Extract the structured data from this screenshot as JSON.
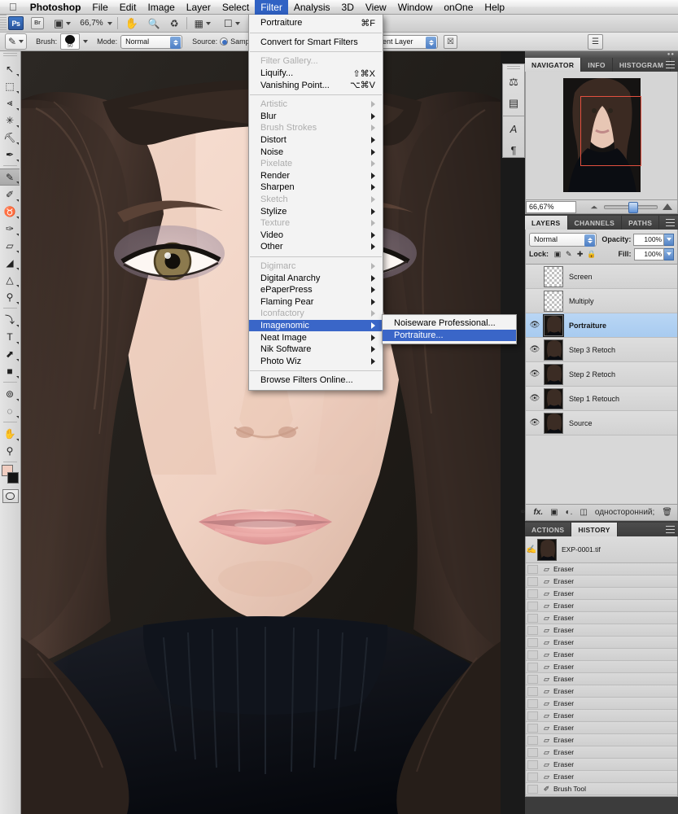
{
  "menubar": {
    "apple_icon": "apple-icon",
    "items": [
      {
        "label": "Photoshop",
        "bold": true,
        "active": false
      },
      {
        "label": "File",
        "bold": false,
        "active": false
      },
      {
        "label": "Edit",
        "bold": false,
        "active": false
      },
      {
        "label": "Image",
        "bold": false,
        "active": false
      },
      {
        "label": "Layer",
        "bold": false,
        "active": false
      },
      {
        "label": "Select",
        "bold": false,
        "active": false
      },
      {
        "label": "Filter",
        "bold": false,
        "active": true
      },
      {
        "label": "Analysis",
        "bold": false,
        "active": false
      },
      {
        "label": "3D",
        "bold": false,
        "active": false
      },
      {
        "label": "View",
        "bold": false,
        "active": false
      },
      {
        "label": "Window",
        "bold": false,
        "active": false
      },
      {
        "label": "onOne",
        "bold": false,
        "active": false
      },
      {
        "label": "Help",
        "bold": false,
        "active": false
      }
    ]
  },
  "options_bar": {
    "app_badge": "Ps",
    "bridge_badge": "Br",
    "zoom_level": "66,7%",
    "icons": [
      "screen-mode-icon",
      "hand-icon",
      "zoom-icon",
      "rotate-view-icon",
      "arrange-documents-icon",
      "screen-mode-toggle-icon"
    ]
  },
  "tool_options": {
    "tool_icon": "healing-brush-icon",
    "brush_label": "Brush:",
    "brush_size": "50",
    "mode_label": "Mode:",
    "mode_value": "Normal",
    "source_label": "Source:",
    "source_option": "Sampled",
    "sample_value": "rrent Layer",
    "airbrush_icon": "airbrush-off-icon",
    "palette_icon": "toggle-brush-panel-icon"
  },
  "toolbar": {
    "tools": [
      {
        "name": "move-tool",
        "glyph": "↖",
        "sub": true,
        "selected": false
      },
      {
        "name": "marquee-tool",
        "glyph": "⬚",
        "sub": true,
        "selected": false
      },
      {
        "name": "lasso-tool",
        "glyph": "⪡",
        "sub": true,
        "selected": false
      },
      {
        "name": "quick-selection-tool",
        "glyph": "✳",
        "sub": true,
        "selected": false
      },
      {
        "name": "crop-tool",
        "glyph": "⛏",
        "sub": true,
        "selected": false
      },
      {
        "name": "eyedropper-tool",
        "glyph": "✒",
        "sub": true,
        "selected": false
      },
      {
        "name": "healing-brush-tool",
        "glyph": "✎",
        "sub": true,
        "selected": true
      },
      {
        "name": "brush-tool",
        "glyph": "✐",
        "sub": true,
        "selected": false
      },
      {
        "name": "clone-stamp-tool",
        "glyph": "♉",
        "sub": true,
        "selected": false
      },
      {
        "name": "history-brush-tool",
        "glyph": "✑",
        "sub": true,
        "selected": false
      },
      {
        "name": "eraser-tool",
        "glyph": "▱",
        "sub": true,
        "selected": false
      },
      {
        "name": "gradient-tool",
        "glyph": "◢",
        "sub": true,
        "selected": false
      },
      {
        "name": "blur-tool",
        "glyph": "△",
        "sub": true,
        "selected": false
      },
      {
        "name": "dodge-tool",
        "glyph": "⚲",
        "sub": true,
        "selected": false
      },
      {
        "name": "pen-tool",
        "glyph": "⤵",
        "sub": true,
        "selected": false
      },
      {
        "name": "type-tool",
        "glyph": "T",
        "sub": true,
        "selected": false
      },
      {
        "name": "path-selection-tool",
        "glyph": "⬈",
        "sub": true,
        "selected": false
      },
      {
        "name": "shape-tool",
        "glyph": "■",
        "sub": true,
        "selected": false
      },
      {
        "name": "3d-rotate-tool",
        "glyph": "⊚",
        "sub": true,
        "selected": false
      },
      {
        "name": "3d-orbit-tool",
        "glyph": "◌",
        "sub": true,
        "selected": false
      },
      {
        "name": "hand-tool",
        "glyph": "✋",
        "sub": true,
        "selected": false
      },
      {
        "name": "zoom-tool",
        "glyph": "⚲",
        "sub": false,
        "selected": false
      }
    ],
    "foreground_color": "#f1cdc0",
    "background_color": "#141414",
    "quick_mask_name": "quick-mask-toggle"
  },
  "filter_menu": {
    "groups": [
      [
        {
          "label": "Portraiture",
          "shortcut": "⌘F",
          "enabled": true,
          "submenu": false
        }
      ],
      [
        {
          "label": "Convert for Smart Filters",
          "shortcut": "",
          "enabled": true,
          "submenu": false
        }
      ],
      [
        {
          "label": "Filter Gallery...",
          "shortcut": "",
          "enabled": false,
          "submenu": false
        },
        {
          "label": "Liquify...",
          "shortcut": "⇧⌘X",
          "enabled": true,
          "submenu": false
        },
        {
          "label": "Vanishing Point...",
          "shortcut": "⌥⌘V",
          "enabled": true,
          "submenu": false
        }
      ],
      [
        {
          "label": "Artistic",
          "shortcut": "",
          "enabled": false,
          "submenu": true
        },
        {
          "label": "Blur",
          "shortcut": "",
          "enabled": true,
          "submenu": true
        },
        {
          "label": "Brush Strokes",
          "shortcut": "",
          "enabled": false,
          "submenu": true
        },
        {
          "label": "Distort",
          "shortcut": "",
          "enabled": true,
          "submenu": true
        },
        {
          "label": "Noise",
          "shortcut": "",
          "enabled": true,
          "submenu": true
        },
        {
          "label": "Pixelate",
          "shortcut": "",
          "enabled": false,
          "submenu": true
        },
        {
          "label": "Render",
          "shortcut": "",
          "enabled": true,
          "submenu": true
        },
        {
          "label": "Sharpen",
          "shortcut": "",
          "enabled": true,
          "submenu": true
        },
        {
          "label": "Sketch",
          "shortcut": "",
          "enabled": false,
          "submenu": true
        },
        {
          "label": "Stylize",
          "shortcut": "",
          "enabled": true,
          "submenu": true
        },
        {
          "label": "Texture",
          "shortcut": "",
          "enabled": false,
          "submenu": true
        },
        {
          "label": "Video",
          "shortcut": "",
          "enabled": true,
          "submenu": true
        },
        {
          "label": "Other",
          "shortcut": "",
          "enabled": true,
          "submenu": true
        }
      ],
      [
        {
          "label": "Digimarc",
          "shortcut": "",
          "enabled": false,
          "submenu": true
        },
        {
          "label": "Digital Anarchy",
          "shortcut": "",
          "enabled": true,
          "submenu": true
        },
        {
          "label": "ePaperPress",
          "shortcut": "",
          "enabled": true,
          "submenu": true
        },
        {
          "label": "Flaming Pear",
          "shortcut": "",
          "enabled": true,
          "submenu": true
        },
        {
          "label": "Iconfactory",
          "shortcut": "",
          "enabled": false,
          "submenu": true
        },
        {
          "label": "Imagenomic",
          "shortcut": "",
          "enabled": true,
          "submenu": true,
          "highlighted": true
        },
        {
          "label": "Neat Image",
          "shortcut": "",
          "enabled": true,
          "submenu": true
        },
        {
          "label": "Nik Software",
          "shortcut": "",
          "enabled": true,
          "submenu": true
        },
        {
          "label": "Photo Wiz",
          "shortcut": "",
          "enabled": true,
          "submenu": true
        }
      ],
      [
        {
          "label": "Browse Filters Online...",
          "shortcut": "",
          "enabled": true,
          "submenu": false
        }
      ]
    ],
    "submenu": {
      "items": [
        {
          "label": "Noiseware Professional...",
          "highlighted": false
        },
        {
          "label": "Portraiture...",
          "highlighted": true
        }
      ]
    },
    "highlight_color": "#3a66c8"
  },
  "mini_dock": {
    "icons": [
      "color-panel-icon",
      "adjustments-panel-icon",
      "character-panel-icon",
      "paragraph-panel-icon"
    ]
  },
  "navigator": {
    "tabs": [
      {
        "label": "NAVIGATOR",
        "active": true
      },
      {
        "label": "INFO",
        "active": false
      },
      {
        "label": "HISTOGRAM",
        "active": false
      }
    ],
    "zoom_value": "66,67%",
    "menu_icon": "panel-menu-icon",
    "zoom_out_icon": "zoom-out-icon",
    "zoom_in_icon": "zoom-in-icon",
    "view_box_color": "#e2503f"
  },
  "layers_panel": {
    "tabs": [
      {
        "label": "LAYERS",
        "active": true
      },
      {
        "label": "CHANNELS",
        "active": false
      },
      {
        "label": "PATHS",
        "active": false
      }
    ],
    "blend_mode": "Normal",
    "opacity_label": "Opacity:",
    "opacity_value": "100%",
    "lock_label": "Lock:",
    "lock_icons": [
      "lock-transparent-pixels-icon",
      "lock-image-pixels-icon",
      "lock-position-icon",
      "lock-all-icon"
    ],
    "fill_label": "Fill:",
    "fill_value": "100%",
    "layers": [
      {
        "name": "Screen",
        "visible": false,
        "selected": false,
        "thumb": "checker"
      },
      {
        "name": "Multiply",
        "visible": false,
        "selected": false,
        "thumb": "checker"
      },
      {
        "name": "Portraiture",
        "visible": true,
        "selected": true,
        "thumb": "photo"
      },
      {
        "name": "Step 3 Retoch",
        "visible": true,
        "selected": false,
        "thumb": "photo"
      },
      {
        "name": "Step 2 Retoch",
        "visible": true,
        "selected": false,
        "thumb": "photo"
      },
      {
        "name": "Step 1 Retouch",
        "visible": true,
        "selected": false,
        "thumb": "photo"
      },
      {
        "name": "Source",
        "visible": true,
        "selected": false,
        "thumb": "photo"
      }
    ],
    "footer_icons": [
      "link-layers-icon",
      "layer-style-fx-icon",
      "layer-mask-icon",
      "adjustment-layer-icon",
      "new-group-icon",
      "new-layer-icon",
      "delete-layer-icon"
    ]
  },
  "history_panel": {
    "tabs": [
      {
        "label": "ACTIONS",
        "active": false
      },
      {
        "label": "HISTORY",
        "active": true
      }
    ],
    "snapshot": {
      "name": "EXP-0001.tif",
      "icon": "snapshot-icon"
    },
    "states": [
      {
        "label": "Eraser",
        "icon": "eraser-icon"
      },
      {
        "label": "Eraser",
        "icon": "eraser-icon"
      },
      {
        "label": "Eraser",
        "icon": "eraser-icon"
      },
      {
        "label": "Eraser",
        "icon": "eraser-icon"
      },
      {
        "label": "Eraser",
        "icon": "eraser-icon"
      },
      {
        "label": "Eraser",
        "icon": "eraser-icon"
      },
      {
        "label": "Eraser",
        "icon": "eraser-icon"
      },
      {
        "label": "Eraser",
        "icon": "eraser-icon"
      },
      {
        "label": "Eraser",
        "icon": "eraser-icon"
      },
      {
        "label": "Eraser",
        "icon": "eraser-icon"
      },
      {
        "label": "Eraser",
        "icon": "eraser-icon"
      },
      {
        "label": "Eraser",
        "icon": "eraser-icon"
      },
      {
        "label": "Eraser",
        "icon": "eraser-icon"
      },
      {
        "label": "Eraser",
        "icon": "eraser-icon"
      },
      {
        "label": "Eraser",
        "icon": "eraser-icon"
      },
      {
        "label": "Eraser",
        "icon": "eraser-icon"
      },
      {
        "label": "Eraser",
        "icon": "eraser-icon"
      },
      {
        "label": "Eraser",
        "icon": "eraser-icon"
      },
      {
        "label": "Brush Tool",
        "icon": "brush-icon"
      }
    ]
  }
}
